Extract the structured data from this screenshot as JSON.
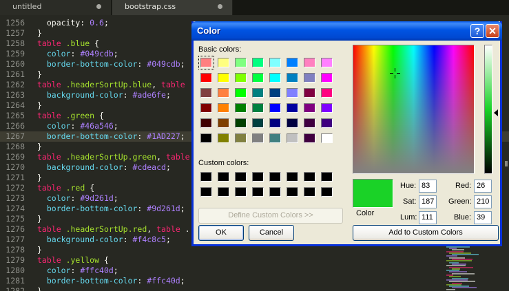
{
  "tabs": [
    {
      "label": "untitled",
      "active": false
    },
    {
      "label": "bootstrap.css",
      "active": true
    }
  ],
  "editor": {
    "current_line": 1267,
    "lines": [
      {
        "n": "1256",
        "tokens": [
          [
            "w",
            "  opacity: "
          ],
          [
            "n",
            "0.6"
          ],
          [
            "w",
            ";"
          ]
        ]
      },
      {
        "n": "1257",
        "tokens": [
          [
            "w",
            "}"
          ]
        ]
      },
      {
        "n": "1258",
        "tokens": [
          [
            "k",
            "table"
          ],
          [
            "w",
            " "
          ],
          [
            "s",
            ".blue"
          ],
          [
            "w",
            " {"
          ]
        ]
      },
      {
        "n": "1259",
        "tokens": [
          [
            "p",
            "  color"
          ],
          [
            "w",
            ": "
          ],
          [
            "n",
            "#049cdb"
          ],
          [
            "w",
            ";"
          ]
        ]
      },
      {
        "n": "1260",
        "tokens": [
          [
            "p",
            "  border-bottom-color"
          ],
          [
            "w",
            ": "
          ],
          [
            "n",
            "#049cdb"
          ],
          [
            "w",
            ";"
          ]
        ]
      },
      {
        "n": "1261",
        "tokens": [
          [
            "w",
            "}"
          ]
        ]
      },
      {
        "n": "1262",
        "tokens": [
          [
            "k",
            "table"
          ],
          [
            "w",
            " "
          ],
          [
            "s",
            ".headerSortUp.blue"
          ],
          [
            "w",
            ", "
          ],
          [
            "k",
            "table"
          ]
        ]
      },
      {
        "n": "1263",
        "tokens": [
          [
            "p",
            "  background-color"
          ],
          [
            "w",
            ": "
          ],
          [
            "n",
            "#ade6fe"
          ],
          [
            "w",
            ";"
          ]
        ]
      },
      {
        "n": "1264",
        "tokens": [
          [
            "w",
            "}"
          ]
        ]
      },
      {
        "n": "1265",
        "tokens": [
          [
            "k",
            "table"
          ],
          [
            "w",
            " "
          ],
          [
            "s",
            ".green"
          ],
          [
            "w",
            " {"
          ]
        ]
      },
      {
        "n": "1266",
        "tokens": [
          [
            "p",
            "  color"
          ],
          [
            "w",
            ": "
          ],
          [
            "n",
            "#46a546"
          ],
          [
            "w",
            ";"
          ]
        ]
      },
      {
        "n": "1267",
        "tokens": [
          [
            "p",
            "  border-bottom-color"
          ],
          [
            "w",
            ": "
          ],
          [
            "n",
            "#1AD227"
          ],
          [
            "w",
            ";"
          ]
        ]
      },
      {
        "n": "1268",
        "tokens": [
          [
            "w",
            "}"
          ]
        ]
      },
      {
        "n": "1269",
        "tokens": [
          [
            "k",
            "table"
          ],
          [
            "w",
            " "
          ],
          [
            "s",
            ".headerSortUp.green"
          ],
          [
            "w",
            ", "
          ],
          [
            "k",
            "table"
          ]
        ]
      },
      {
        "n": "1270",
        "tokens": [
          [
            "p",
            "  background-color"
          ],
          [
            "w",
            ": "
          ],
          [
            "n",
            "#cdeacd"
          ],
          [
            "w",
            ";"
          ]
        ]
      },
      {
        "n": "1271",
        "tokens": [
          [
            "w",
            "}"
          ]
        ]
      },
      {
        "n": "1272",
        "tokens": [
          [
            "k",
            "table"
          ],
          [
            "w",
            " "
          ],
          [
            "s",
            ".red"
          ],
          [
            "w",
            " {"
          ]
        ]
      },
      {
        "n": "1273",
        "tokens": [
          [
            "p",
            "  color"
          ],
          [
            "w",
            ": "
          ],
          [
            "n",
            "#9d261d"
          ],
          [
            "w",
            ";"
          ]
        ]
      },
      {
        "n": "1274",
        "tokens": [
          [
            "p",
            "  border-bottom-color"
          ],
          [
            "w",
            ": "
          ],
          [
            "n",
            "#9d261d"
          ],
          [
            "w",
            ";"
          ]
        ]
      },
      {
        "n": "1275",
        "tokens": [
          [
            "w",
            "}"
          ]
        ]
      },
      {
        "n": "1276",
        "tokens": [
          [
            "k",
            "table"
          ],
          [
            "w",
            " "
          ],
          [
            "s",
            ".headerSortUp.red"
          ],
          [
            "w",
            ", "
          ],
          [
            "k",
            "table"
          ],
          [
            "w",
            " ."
          ]
        ]
      },
      {
        "n": "1277",
        "tokens": [
          [
            "p",
            "  background-color"
          ],
          [
            "w",
            ": "
          ],
          [
            "n",
            "#f4c8c5"
          ],
          [
            "w",
            ";"
          ]
        ]
      },
      {
        "n": "1278",
        "tokens": [
          [
            "w",
            "}"
          ]
        ]
      },
      {
        "n": "1279",
        "tokens": [
          [
            "k",
            "table"
          ],
          [
            "w",
            " "
          ],
          [
            "s",
            ".yellow"
          ],
          [
            "w",
            " {"
          ]
        ]
      },
      {
        "n": "1280",
        "tokens": [
          [
            "p",
            "  color"
          ],
          [
            "w",
            ": "
          ],
          [
            "n",
            "#ffc40d"
          ],
          [
            "w",
            ";"
          ]
        ]
      },
      {
        "n": "1281",
        "tokens": [
          [
            "p",
            "  border-bottom-color"
          ],
          [
            "w",
            ": "
          ],
          [
            "n",
            "#ffc40d"
          ],
          [
            "w",
            ";"
          ]
        ]
      },
      {
        "n": "1282",
        "tokens": [
          [
            "w",
            "}"
          ]
        ]
      }
    ]
  },
  "dialog": {
    "title": "Color",
    "help_label": "?",
    "close_label": "✕",
    "basic_colors_label": "Basic colors:",
    "basic_colors": [
      [
        "#ff8080",
        "#ffff80",
        "#80ff80",
        "#00ff80",
        "#80ffff",
        "#0080ff",
        "#ff80c0",
        "#ff80ff"
      ],
      [
        "#ff0000",
        "#ffff00",
        "#80ff00",
        "#00ff40",
        "#00ffff",
        "#0080c0",
        "#8080c0",
        "#ff00ff"
      ],
      [
        "#804040",
        "#ff8040",
        "#00ff00",
        "#008080",
        "#004080",
        "#8080ff",
        "#800040",
        "#ff0080"
      ],
      [
        "#800000",
        "#ff8000",
        "#008000",
        "#008040",
        "#0000ff",
        "#0000a0",
        "#800080",
        "#8000ff"
      ],
      [
        "#400000",
        "#804000",
        "#004000",
        "#004040",
        "#000080",
        "#000040",
        "#400040",
        "#400080"
      ],
      [
        "#000000",
        "#808000",
        "#808040",
        "#808080",
        "#408080",
        "#c0c0c0",
        "#400040",
        "#ffffff"
      ]
    ],
    "custom_colors_label": "Custom colors:",
    "custom_colors": [
      [
        "#000000",
        "#000000",
        "#000000",
        "#000000",
        "#000000",
        "#000000",
        "#000000",
        "#000000"
      ],
      [
        "#000000",
        "#000000",
        "#000000",
        "#000000",
        "#000000",
        "#000000",
        "#000000",
        "#000000"
      ]
    ],
    "define_custom_label": "Define Custom Colors >>",
    "ok_label": "OK",
    "cancel_label": "Cancel",
    "add_custom_label": "Add to Custom Colors",
    "color_solid_label": "Color",
    "preview_color": "#1ad227",
    "hue_label": "Hue:",
    "sat_label": "Sat:",
    "lum_label": "Lum:",
    "red_label": "Red:",
    "green_label": "Green:",
    "blue_label": "Blue:",
    "hue": "83",
    "sat": "187",
    "lum": "111",
    "red": "26",
    "green": "210",
    "blue": "39"
  }
}
